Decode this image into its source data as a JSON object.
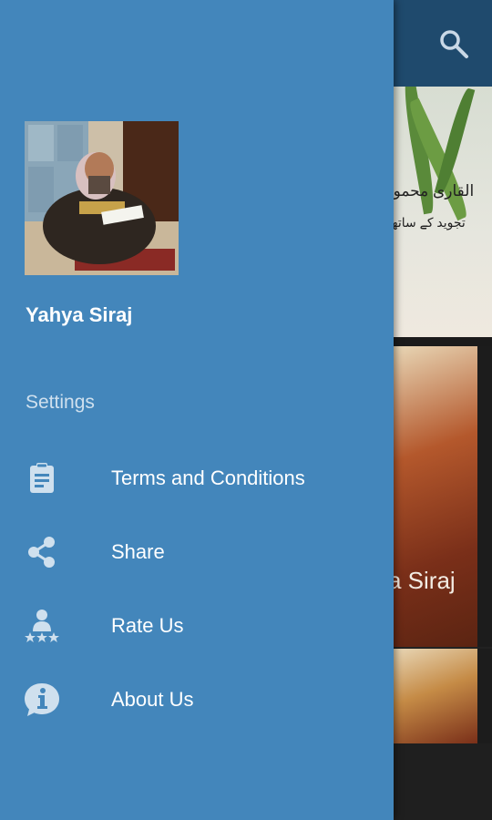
{
  "background": {
    "card1_lines": [
      "القاری محمود",
      "تجوید کے ساتھ"
    ],
    "card2_name": "a Siraj"
  },
  "drawer": {
    "profile_name": "Yahya Siraj",
    "section_label": "Settings",
    "items": [
      {
        "label": "Terms and Conditions",
        "icon": "clipboard-icon"
      },
      {
        "label": "Share",
        "icon": "share-icon"
      },
      {
        "label": "Rate Us",
        "icon": "rate-icon"
      },
      {
        "label": "About Us",
        "icon": "info-icon"
      }
    ]
  },
  "colors": {
    "drawer_bg": "#4386bb",
    "toolbar_bg": "#1f4a6d",
    "icon_color": "#cfe0ee"
  }
}
